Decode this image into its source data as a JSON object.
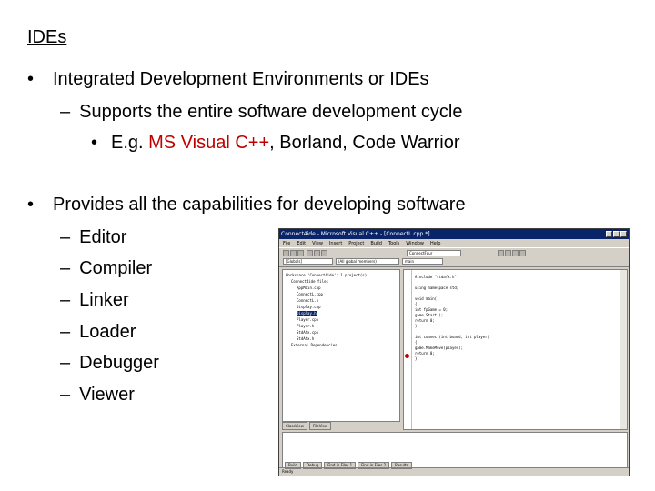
{
  "slide": {
    "title": "IDEs",
    "bullets": [
      {
        "text": "Integrated Development Environments or IDEs"
      },
      {
        "text": "Provides all the capabilities for developing software"
      }
    ],
    "sub1": "Supports the entire software development cycle",
    "example_prefix": "E.g. ",
    "example_red": "MS Visual C++",
    "example_rest": ", Borland, Code Warrior",
    "dash_items": [
      "Editor",
      "Compiler",
      "Linker",
      "Loader",
      "Debugger",
      "Viewer"
    ],
    "bullet_char": "•",
    "dash_char": "–"
  },
  "screenshot": {
    "title": "Connect4ide - Microsoft Visual C++ - [ConnectL.cpp *]",
    "menu": [
      "File",
      "Edit",
      "View",
      "Insert",
      "Project",
      "Build",
      "Tools",
      "Window",
      "Help"
    ],
    "combo1": "ConnectFour",
    "combo2": "[Globals]",
    "combo3": "(All global members)",
    "combo4": "main",
    "tree": [
      "Workspace 'Connect4ide': 1 project(s)",
      "Connect4ide files",
      "AppMain.cpp",
      "ConnectL.cpp",
      "ConnectL.h",
      "Display.cpp",
      "Display.h",
      "Player.cpp",
      "Player.h",
      "StdAfx.cpp",
      "StdAfx.h",
      "External Dependencies"
    ],
    "ws_tabs": [
      "ClassView",
      "FileView"
    ],
    "code": [
      "#include \"stdafx.h\"",
      "",
      "using namespace std;",
      "",
      "void main()",
      "{",
      "    int fpGame = 0;",
      "    game.Start();",
      "    return 0;",
      "}",
      "",
      "int connect(int board, int player)",
      "{",
      "    game.MakeMove(player);",
      "    return 0;",
      "}"
    ],
    "out_tabs": [
      "Build",
      "Debug",
      "Find in Files 1",
      "Find in Files 2",
      "Results"
    ],
    "status": "Ready"
  }
}
